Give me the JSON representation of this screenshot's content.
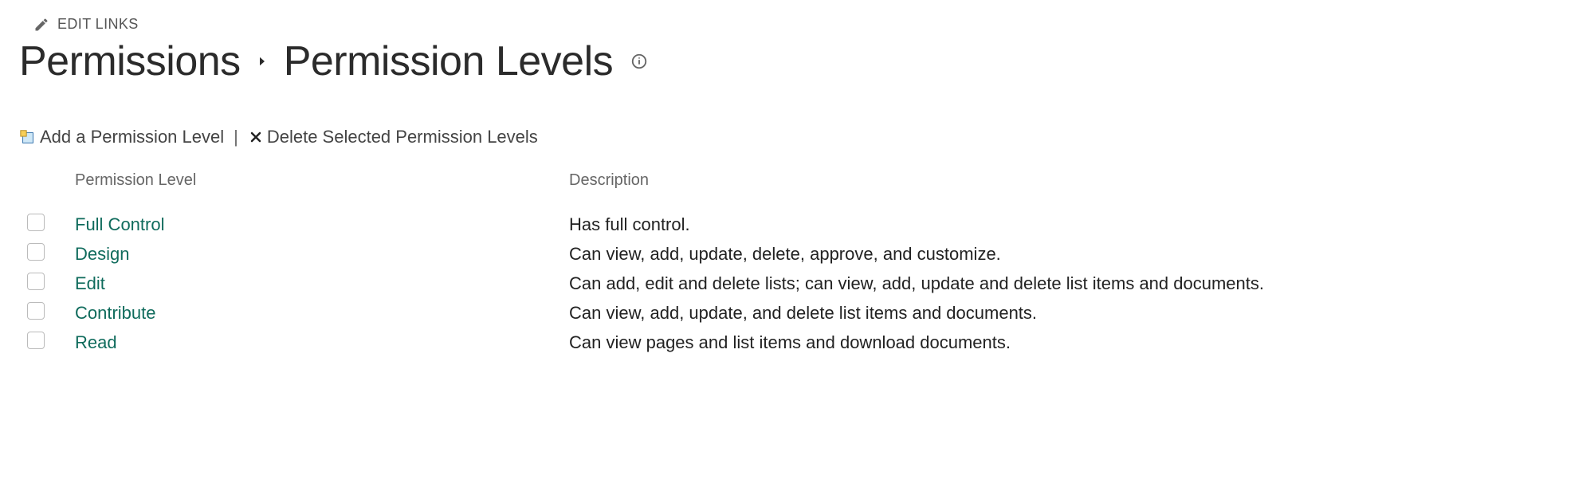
{
  "editLinks": {
    "label": "EDIT LINKS"
  },
  "breadcrumb": {
    "parent": "Permissions",
    "current": "Permission Levels"
  },
  "toolbar": {
    "add": "Add a Permission Level",
    "del": "Delete Selected Permission Levels"
  },
  "table": {
    "headers": {
      "name": "Permission Level",
      "desc": "Description"
    },
    "rows": [
      {
        "name": "Full Control",
        "desc": "Has full control."
      },
      {
        "name": "Design",
        "desc": "Can view, add, update, delete, approve, and customize."
      },
      {
        "name": "Edit",
        "desc": "Can add, edit and delete lists; can view, add, update and delete list items and documents."
      },
      {
        "name": "Contribute",
        "desc": "Can view, add, update, and delete list items and documents."
      },
      {
        "name": "Read",
        "desc": "Can view pages and list items and download documents."
      }
    ]
  }
}
